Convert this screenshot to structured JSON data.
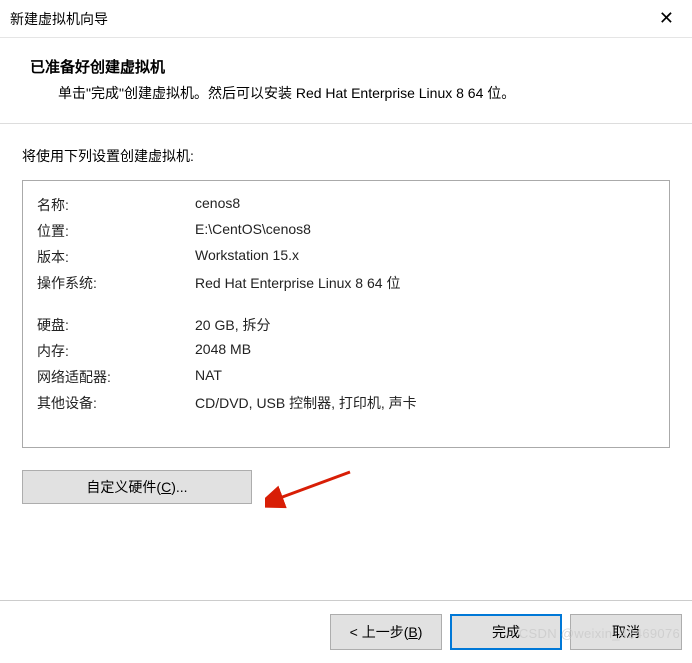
{
  "window": {
    "title": "新建虚拟机向导"
  },
  "header": {
    "title": "已准备好创建虚拟机",
    "subtitle": "单击\"完成\"创建虚拟机。然后可以安装 Red Hat Enterprise Linux 8 64 位。"
  },
  "body": {
    "intro": "将使用下列设置创建虚拟机:"
  },
  "summary": {
    "rows": [
      {
        "label": "名称:",
        "value": "cenos8"
      },
      {
        "label": "位置:",
        "value": "E:\\CentOS\\cenos8"
      },
      {
        "label": "版本:",
        "value": "Workstation 15.x"
      },
      {
        "label": "操作系统:",
        "value": "Red Hat Enterprise Linux 8 64 位"
      }
    ],
    "rows2": [
      {
        "label": "硬盘:",
        "value": "20 GB, 拆分"
      },
      {
        "label": "内存:",
        "value": "2048 MB"
      },
      {
        "label": "网络适配器:",
        "value": "NAT"
      },
      {
        "label": "其他设备:",
        "value": "CD/DVD, USB 控制器, 打印机, 声卡"
      }
    ]
  },
  "buttons": {
    "customize_pre": "自定义硬件(",
    "customize_u": "C",
    "customize_post": ")...",
    "back_pre": "< 上一步(",
    "back_u": "B",
    "back_post": ")",
    "finish": "完成",
    "cancel": "取消"
  },
  "watermark": "CSDN @weixin_42469076"
}
